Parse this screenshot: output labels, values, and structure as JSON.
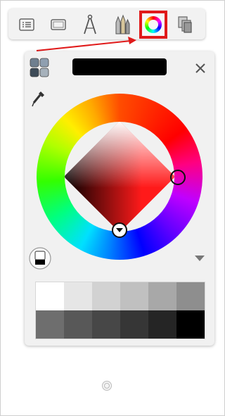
{
  "toolbar": {
    "tools": [
      {
        "name": "layers-list-icon"
      },
      {
        "name": "canvas-icon"
      },
      {
        "name": "ruler-compass-icon"
      },
      {
        "name": "brushes-icon"
      },
      {
        "name": "color-wheel-icon",
        "selected": true
      },
      {
        "name": "copy-icon"
      }
    ]
  },
  "annotation": {
    "highlight_color": "#e01a1a"
  },
  "color_panel": {
    "current_color": "#000000",
    "selected_hue": "#ff0000",
    "swatches": [
      "#ffffff",
      "#e6e6e6",
      "#d2d2d2",
      "#c0c0c0",
      "#a8a8a8",
      "#8e8e8e",
      "#6e6e6e",
      "#585858",
      "#474747",
      "#363636",
      "#252525",
      "#000000"
    ]
  }
}
